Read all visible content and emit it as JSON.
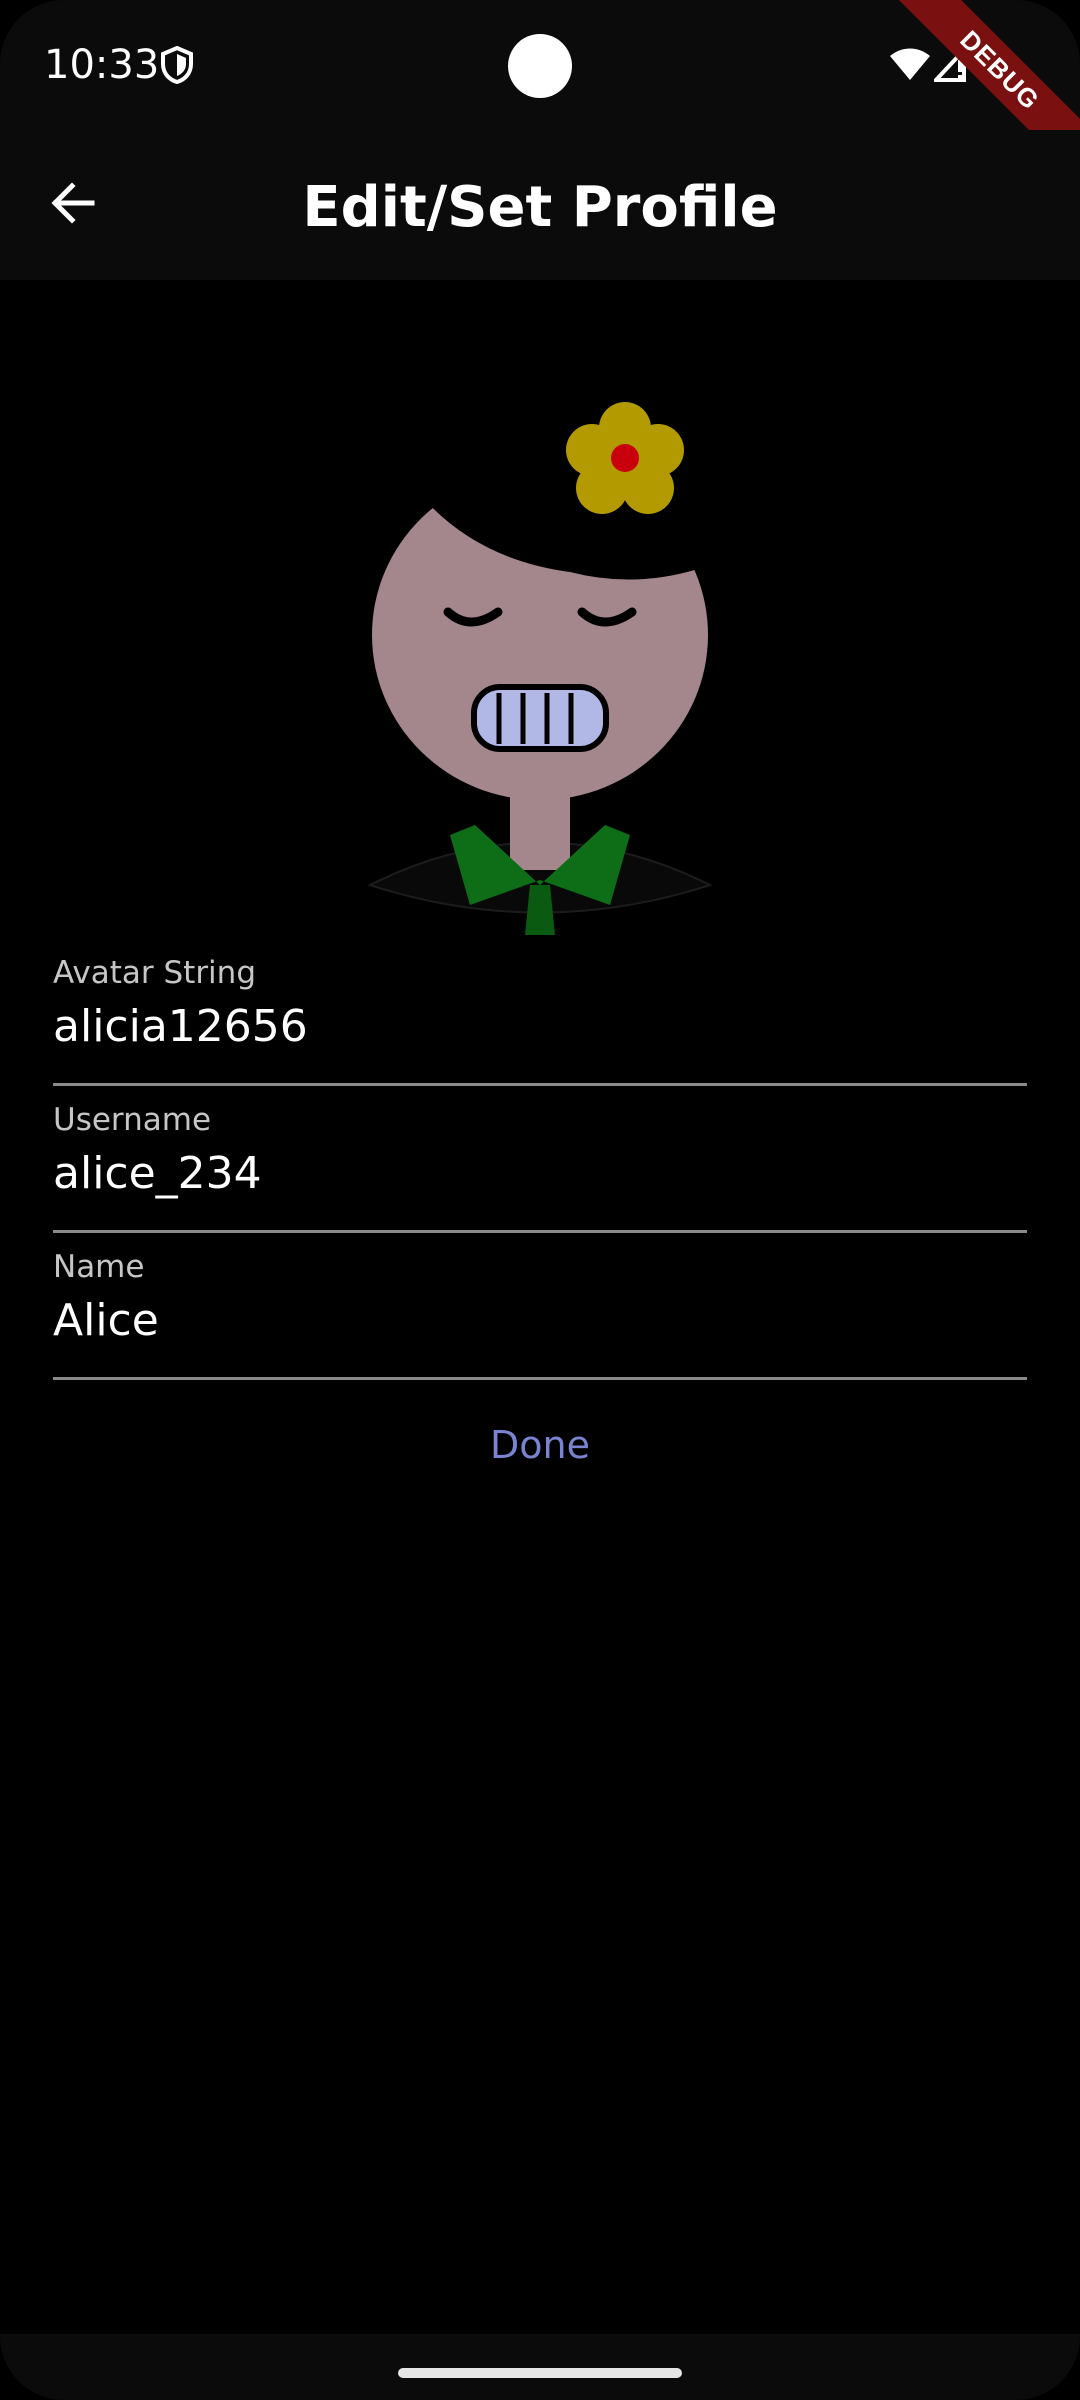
{
  "status_bar": {
    "time": "10:33",
    "debug_label": "DEBUG"
  },
  "app_bar": {
    "title": "Edit/Set Profile",
    "back_icon": "arrow-back-icon"
  },
  "avatar": {
    "description_icon": "avatar-icon"
  },
  "form": {
    "avatar_string": {
      "label": "Avatar String",
      "value": "alicia12656"
    },
    "username": {
      "label": "Username",
      "value": "alice_234"
    },
    "name": {
      "label": "Name",
      "value": "Alice"
    }
  },
  "actions": {
    "done_label": "Done"
  },
  "colors": {
    "accent": "#7a83d0",
    "background": "#000000",
    "app_bar": "#0b0b0b",
    "divider": "#8a8a8a"
  }
}
